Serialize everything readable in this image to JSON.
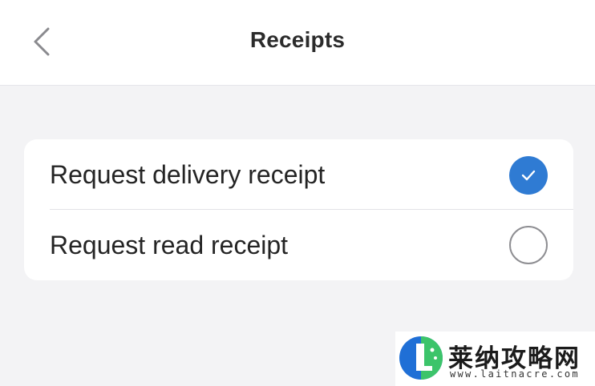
{
  "header": {
    "title": "Receipts",
    "back_icon": "chevron-left-icon"
  },
  "settings": {
    "items": [
      {
        "label": "Request delivery receipt",
        "checked": true
      },
      {
        "label": "Request read receipt",
        "checked": false
      }
    ]
  },
  "watermark": {
    "name": "莱纳攻略网",
    "url": "www.laitnacre.com"
  },
  "colors": {
    "accent": "#2f7bd3",
    "background": "#f3f3f5",
    "card": "#ffffff",
    "text": "#242424"
  }
}
